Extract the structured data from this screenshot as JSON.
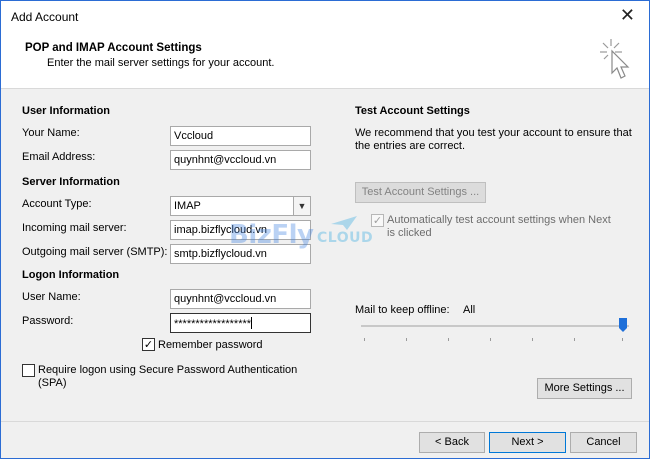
{
  "window": {
    "title": "Add Account",
    "close_glyph": "✕"
  },
  "header": {
    "title": "POP and IMAP Account Settings",
    "subtitle": "Enter the mail server settings for your account.",
    "icon": "cursor-sparkle-icon"
  },
  "user_info": {
    "section": "User Information",
    "name_label": "Your Name:",
    "name_value": "Vccloud",
    "email_label": "Email Address:",
    "email_value": "quynhnt@vccloud.vn"
  },
  "server_info": {
    "section": "Server Information",
    "account_type_label": "Account Type:",
    "account_type_value": "IMAP",
    "incoming_label": "Incoming mail server:",
    "incoming_value": "imap.bizflycloud.vn",
    "outgoing_label": "Outgoing mail server (SMTP):",
    "outgoing_value": "smtp.bizflycloud.vn"
  },
  "logon_info": {
    "section": "Logon Information",
    "username_label": "User Name:",
    "username_value": "quynhnt@vccloud.vn",
    "password_label": "Password:",
    "password_value": "******************",
    "remember_label": "Remember password",
    "remember_checked": true,
    "spa_label_line1": "Require logon using Secure Password Authentication",
    "spa_label_line2": "(SPA)",
    "spa_checked": false
  },
  "test_settings": {
    "section": "Test Account Settings",
    "desc_line1": "We recommend that you test your account to ensure that",
    "desc_line2": "the entries are correct.",
    "test_button": "Test Account Settings ...",
    "auto_test_line1": "Automatically test account settings when Next",
    "auto_test_line2": "is clicked",
    "auto_test_checked": true
  },
  "offline": {
    "label": "Mail to keep offline:",
    "value": "All",
    "level_percent": 100
  },
  "more_settings_button": "More Settings ...",
  "footer": {
    "back": "< Back",
    "next": "Next >",
    "cancel": "Cancel"
  },
  "watermark": {
    "brand": "BizFly",
    "suffix": "CLOUD"
  },
  "colors": {
    "accent": "#0078d7",
    "slider_thumb": "#1e6fd9",
    "border": "#a9a9a9"
  }
}
